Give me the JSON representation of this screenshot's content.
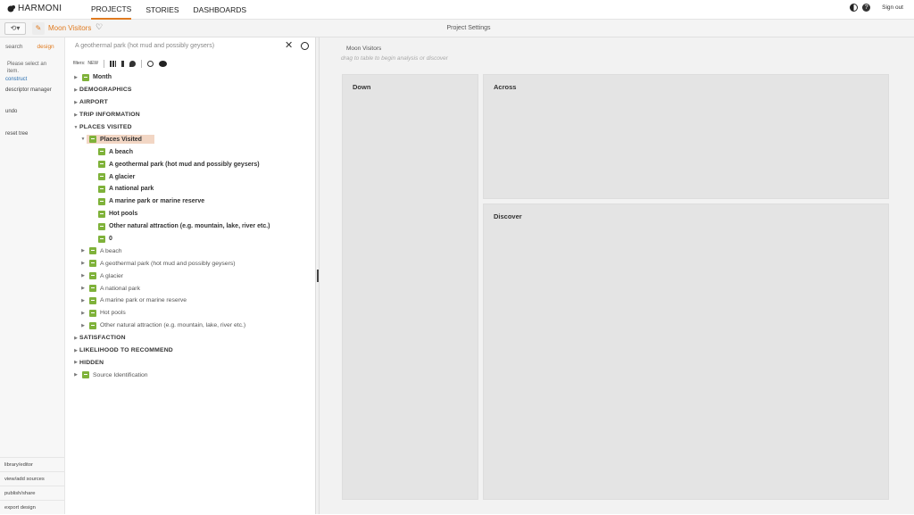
{
  "app": {
    "logo": "HARMONI"
  },
  "nav": {
    "items": [
      "PROJECTS",
      "STORIES",
      "DASHBOARDS"
    ],
    "active": 0
  },
  "topright": {
    "signout": "Sign out"
  },
  "toolbar": {
    "project_name": "Moon Visitors",
    "center_title": "Project Settings"
  },
  "leftcol": {
    "tabs": [
      "search",
      "design"
    ],
    "active_tab": 1,
    "message": "Please select an item.",
    "links": [
      "construct",
      "descriptor manager",
      "undo",
      "reset tree"
    ],
    "bottom": [
      "library/editor",
      "view/add sources",
      "publish/share",
      "export design"
    ]
  },
  "search": {
    "query": "A geothermal park (hot mud and possibly geysers)"
  },
  "filters": {
    "label": "filters:",
    "new": "NEW"
  },
  "tree": {
    "rows": [
      {
        "label": "Month",
        "type": "var",
        "level": 0,
        "bold": true
      },
      {
        "label": "DEMOGRAPHICS",
        "type": "cat",
        "level": 0
      },
      {
        "label": "AIRPORT",
        "type": "cat",
        "level": 0
      },
      {
        "label": "TRIP INFORMATION",
        "type": "cat",
        "level": 0
      },
      {
        "label": "PLACES VISITED",
        "type": "cat",
        "level": 0,
        "open": true
      },
      {
        "label": "Places Visited",
        "type": "var",
        "level": 1,
        "bold": true,
        "selected": true,
        "open": true
      },
      {
        "label": "A beach",
        "type": "leaf",
        "level": 2,
        "bold": true
      },
      {
        "label": "A geothermal park (hot mud and possibly geysers)",
        "type": "leaf",
        "level": 2,
        "bold": true
      },
      {
        "label": "A glacier",
        "type": "leaf",
        "level": 2,
        "bold": true
      },
      {
        "label": "A national park",
        "type": "leaf",
        "level": 2,
        "bold": true
      },
      {
        "label": "A marine park or marine reserve",
        "type": "leaf",
        "level": 2,
        "bold": true
      },
      {
        "label": "Hot pools",
        "type": "leaf",
        "level": 2,
        "bold": true
      },
      {
        "label": "Other natural attraction (e.g. mountain, lake, river etc.)",
        "type": "leaf",
        "level": 2,
        "bold": true
      },
      {
        "label": "0",
        "type": "leaf",
        "level": 2,
        "bold": true
      },
      {
        "label": "A beach",
        "type": "var",
        "level": 1
      },
      {
        "label": "A geothermal park (hot mud and possibly geysers)",
        "type": "var",
        "level": 1
      },
      {
        "label": "A glacier",
        "type": "var",
        "level": 1
      },
      {
        "label": "A national park",
        "type": "var",
        "level": 1
      },
      {
        "label": "A marine park or marine reserve",
        "type": "var",
        "level": 1
      },
      {
        "label": "Hot pools",
        "type": "var",
        "level": 1
      },
      {
        "label": "Other natural attraction (e.g. mountain, lake, river etc.)",
        "type": "var",
        "level": 1
      },
      {
        "label": "SATISFACTION",
        "type": "cat",
        "level": 0
      },
      {
        "label": "LIKELIHOOD TO RECOMMEND",
        "type": "cat",
        "level": 0
      },
      {
        "label": "HIDDEN",
        "type": "cat",
        "level": 0
      },
      {
        "label": "Source Identification",
        "type": "var",
        "level": 0
      }
    ]
  },
  "main": {
    "title": "Moon Visitors",
    "hint": "drag to table to begin analysis or discover",
    "boxes": {
      "down": "Down",
      "across": "Across",
      "discover": "Discover"
    }
  },
  "colors": {
    "accent": "#e07a1f",
    "variable_green": "#7fb23a",
    "selected_bg": "#f2d6c4"
  }
}
